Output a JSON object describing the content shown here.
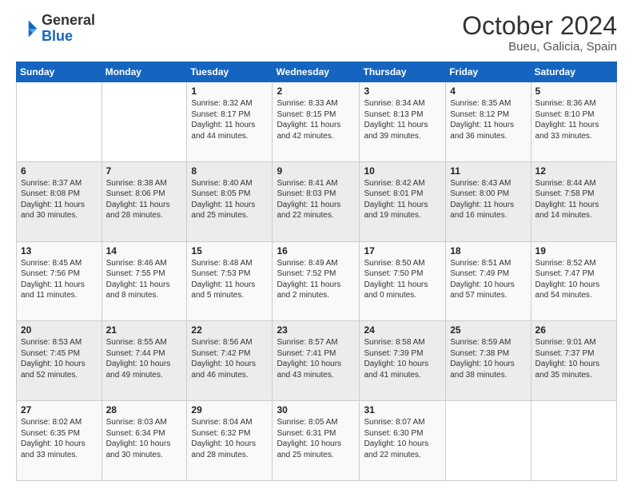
{
  "header": {
    "logo_general": "General",
    "logo_blue": "Blue",
    "month_title": "October 2024",
    "location": "Bueu, Galicia, Spain"
  },
  "weekdays": [
    "Sunday",
    "Monday",
    "Tuesday",
    "Wednesday",
    "Thursday",
    "Friday",
    "Saturday"
  ],
  "weeks": [
    [
      {
        "day": "",
        "info": ""
      },
      {
        "day": "",
        "info": ""
      },
      {
        "day": "1",
        "info": "Sunrise: 8:32 AM\nSunset: 8:17 PM\nDaylight: 11 hours and 44 minutes."
      },
      {
        "day": "2",
        "info": "Sunrise: 8:33 AM\nSunset: 8:15 PM\nDaylight: 11 hours and 42 minutes."
      },
      {
        "day": "3",
        "info": "Sunrise: 8:34 AM\nSunset: 8:13 PM\nDaylight: 11 hours and 39 minutes."
      },
      {
        "day": "4",
        "info": "Sunrise: 8:35 AM\nSunset: 8:12 PM\nDaylight: 11 hours and 36 minutes."
      },
      {
        "day": "5",
        "info": "Sunrise: 8:36 AM\nSunset: 8:10 PM\nDaylight: 11 hours and 33 minutes."
      }
    ],
    [
      {
        "day": "6",
        "info": "Sunrise: 8:37 AM\nSunset: 8:08 PM\nDaylight: 11 hours and 30 minutes."
      },
      {
        "day": "7",
        "info": "Sunrise: 8:38 AM\nSunset: 8:06 PM\nDaylight: 11 hours and 28 minutes."
      },
      {
        "day": "8",
        "info": "Sunrise: 8:40 AM\nSunset: 8:05 PM\nDaylight: 11 hours and 25 minutes."
      },
      {
        "day": "9",
        "info": "Sunrise: 8:41 AM\nSunset: 8:03 PM\nDaylight: 11 hours and 22 minutes."
      },
      {
        "day": "10",
        "info": "Sunrise: 8:42 AM\nSunset: 8:01 PM\nDaylight: 11 hours and 19 minutes."
      },
      {
        "day": "11",
        "info": "Sunrise: 8:43 AM\nSunset: 8:00 PM\nDaylight: 11 hours and 16 minutes."
      },
      {
        "day": "12",
        "info": "Sunrise: 8:44 AM\nSunset: 7:58 PM\nDaylight: 11 hours and 14 minutes."
      }
    ],
    [
      {
        "day": "13",
        "info": "Sunrise: 8:45 AM\nSunset: 7:56 PM\nDaylight: 11 hours and 11 minutes."
      },
      {
        "day": "14",
        "info": "Sunrise: 8:46 AM\nSunset: 7:55 PM\nDaylight: 11 hours and 8 minutes."
      },
      {
        "day": "15",
        "info": "Sunrise: 8:48 AM\nSunset: 7:53 PM\nDaylight: 11 hours and 5 minutes."
      },
      {
        "day": "16",
        "info": "Sunrise: 8:49 AM\nSunset: 7:52 PM\nDaylight: 11 hours and 2 minutes."
      },
      {
        "day": "17",
        "info": "Sunrise: 8:50 AM\nSunset: 7:50 PM\nDaylight: 11 hours and 0 minutes."
      },
      {
        "day": "18",
        "info": "Sunrise: 8:51 AM\nSunset: 7:49 PM\nDaylight: 10 hours and 57 minutes."
      },
      {
        "day": "19",
        "info": "Sunrise: 8:52 AM\nSunset: 7:47 PM\nDaylight: 10 hours and 54 minutes."
      }
    ],
    [
      {
        "day": "20",
        "info": "Sunrise: 8:53 AM\nSunset: 7:45 PM\nDaylight: 10 hours and 52 minutes."
      },
      {
        "day": "21",
        "info": "Sunrise: 8:55 AM\nSunset: 7:44 PM\nDaylight: 10 hours and 49 minutes."
      },
      {
        "day": "22",
        "info": "Sunrise: 8:56 AM\nSunset: 7:42 PM\nDaylight: 10 hours and 46 minutes."
      },
      {
        "day": "23",
        "info": "Sunrise: 8:57 AM\nSunset: 7:41 PM\nDaylight: 10 hours and 43 minutes."
      },
      {
        "day": "24",
        "info": "Sunrise: 8:58 AM\nSunset: 7:39 PM\nDaylight: 10 hours and 41 minutes."
      },
      {
        "day": "25",
        "info": "Sunrise: 8:59 AM\nSunset: 7:38 PM\nDaylight: 10 hours and 38 minutes."
      },
      {
        "day": "26",
        "info": "Sunrise: 9:01 AM\nSunset: 7:37 PM\nDaylight: 10 hours and 35 minutes."
      }
    ],
    [
      {
        "day": "27",
        "info": "Sunrise: 8:02 AM\nSunset: 6:35 PM\nDaylight: 10 hours and 33 minutes."
      },
      {
        "day": "28",
        "info": "Sunrise: 8:03 AM\nSunset: 6:34 PM\nDaylight: 10 hours and 30 minutes."
      },
      {
        "day": "29",
        "info": "Sunrise: 8:04 AM\nSunset: 6:32 PM\nDaylight: 10 hours and 28 minutes."
      },
      {
        "day": "30",
        "info": "Sunrise: 8:05 AM\nSunset: 6:31 PM\nDaylight: 10 hours and 25 minutes."
      },
      {
        "day": "31",
        "info": "Sunrise: 8:07 AM\nSunset: 6:30 PM\nDaylight: 10 hours and 22 minutes."
      },
      {
        "day": "",
        "info": ""
      },
      {
        "day": "",
        "info": ""
      }
    ]
  ]
}
